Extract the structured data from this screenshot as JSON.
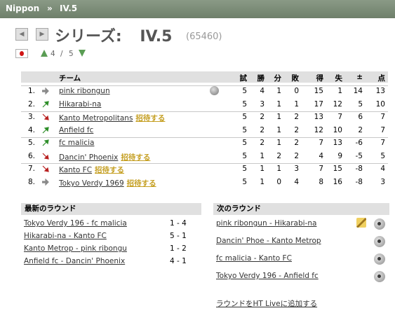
{
  "breadcrumb": {
    "root": "Nippon",
    "sep": "»",
    "current": "IV.5"
  },
  "header": {
    "prefix": "シリーズ:",
    "name": "IV.5",
    "id": "(65460)",
    "level_current": "4",
    "level_sep": "/",
    "level_total": "5"
  },
  "table": {
    "headers": {
      "team": "チーム",
      "played": "試",
      "won": "勝",
      "draw": "分",
      "lost": "敗",
      "gf": "得",
      "ga": "失",
      "diff": "±",
      "pts": "点"
    },
    "invite_label": "招待する",
    "rows": [
      {
        "pos": "1.",
        "trend": "same",
        "team": "pink ribongun",
        "invite": false,
        "played": "5",
        "won": "4",
        "draw": "1",
        "lost": "0",
        "gf": "15",
        "ga": "1",
        "diff": "14",
        "pts": "13"
      },
      {
        "pos": "2.",
        "trend": "up",
        "team": "Hikarabi-na",
        "invite": false,
        "played": "5",
        "won": "3",
        "draw": "1",
        "lost": "1",
        "gf": "17",
        "ga": "12",
        "diff": "5",
        "pts": "10"
      },
      {
        "pos": "3.",
        "trend": "down",
        "team": "Kanto Metropolitans",
        "invite": true,
        "played": "5",
        "won": "2",
        "draw": "1",
        "lost": "2",
        "gf": "13",
        "ga": "7",
        "diff": "6",
        "pts": "7"
      },
      {
        "pos": "4.",
        "trend": "up",
        "team": "Anfield fc",
        "invite": false,
        "played": "5",
        "won": "2",
        "draw": "1",
        "lost": "2",
        "gf": "12",
        "ga": "10",
        "diff": "2",
        "pts": "7"
      },
      {
        "pos": "5.",
        "trend": "up",
        "team": "fc malicia",
        "invite": false,
        "played": "5",
        "won": "2",
        "draw": "1",
        "lost": "2",
        "gf": "7",
        "ga": "13",
        "diff": "-6",
        "pts": "7"
      },
      {
        "pos": "6.",
        "trend": "down",
        "team": "Dancin' Phoenix",
        "invite": true,
        "played": "5",
        "won": "1",
        "draw": "2",
        "lost": "2",
        "gf": "4",
        "ga": "9",
        "diff": "-5",
        "pts": "5"
      },
      {
        "pos": "7.",
        "trend": "down",
        "team": "Kanto FC",
        "invite": true,
        "played": "5",
        "won": "1",
        "draw": "1",
        "lost": "3",
        "gf": "7",
        "ga": "15",
        "diff": "-8",
        "pts": "4"
      },
      {
        "pos": "8.",
        "trend": "same",
        "team": "Tokyo Verdy 1969",
        "invite": true,
        "played": "5",
        "won": "1",
        "draw": "0",
        "lost": "4",
        "gf": "8",
        "ga": "16",
        "diff": "-8",
        "pts": "3"
      }
    ]
  },
  "latest": {
    "title": "最新のラウンド",
    "matches": [
      {
        "name": "Tokyo Verdy 196 - fc malicia",
        "score": "1 - 4"
      },
      {
        "name": "Hikarabi-na - Kanto FC",
        "score": "5 - 1"
      },
      {
        "name": "Kanto Metrop - pink ribongu",
        "score": "1 - 2"
      },
      {
        "name": "Anfield fc - Dancin' Phoenix",
        "score": "4 - 1"
      }
    ]
  },
  "next": {
    "title": "次のラウンド",
    "matches": [
      {
        "name": "pink ribongun - Hikarabi-na"
      },
      {
        "name": "Dancin' Phoe - Kanto Metrop"
      },
      {
        "name": "fc malicia - Kanto FC"
      },
      {
        "name": "Tokyo Verdy 196 - Anfield fc"
      }
    ],
    "add_live": "ラウンドをHT Liveに追加する"
  },
  "colors": {
    "up": "#2f8f2a",
    "down": "#b82020",
    "same": "#8a8a8a",
    "invite": "#c59f22"
  }
}
